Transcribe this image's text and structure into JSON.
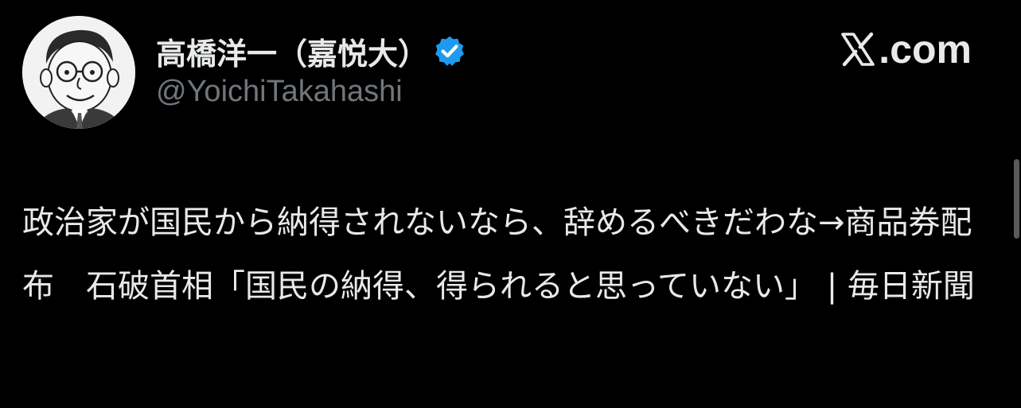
{
  "author": {
    "display_name": "高橋洋一（嘉悦大）",
    "handle": "@YoichiTakahashi",
    "verified_icon": "verified-badge-icon",
    "avatar_icon": "caricature-avatar"
  },
  "brand": {
    "logo_icon": "x-logo-icon",
    "text": ".com"
  },
  "tweet": {
    "text": "政治家が国民から納得されないなら、辞めるべきだわな→商品券配布　石破首相「国民の納得、得られると思っていない」 | 毎日新聞"
  },
  "colors": {
    "background": "#000000",
    "text_primary": "#e7e9ea",
    "text_secondary": "#71767b",
    "verified_blue": "#1d9bf0"
  }
}
